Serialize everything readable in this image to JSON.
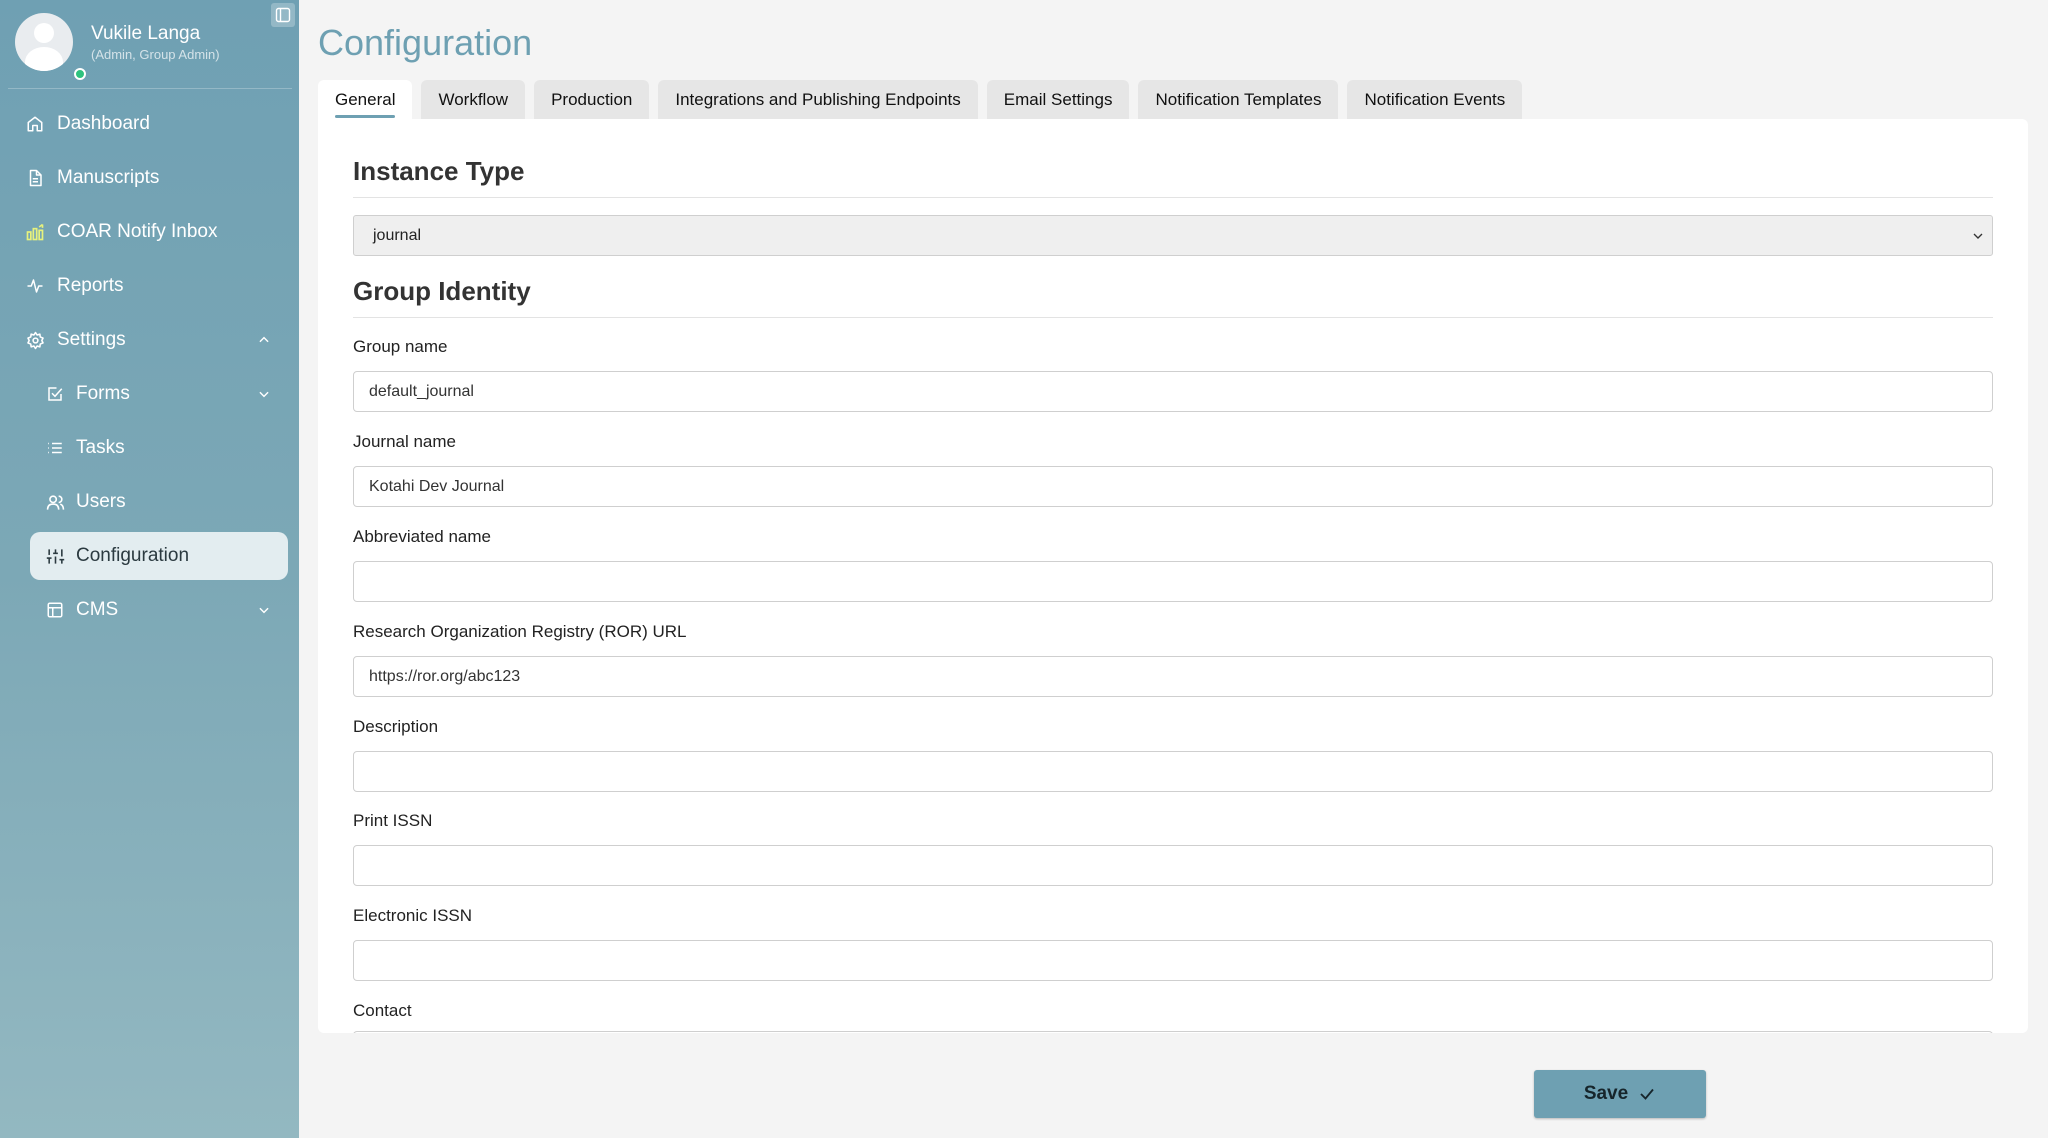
{
  "user": {
    "name": "Vukile Langa",
    "role": "(Admin, Group Admin)",
    "status_color": "#2ec27e"
  },
  "sidebar": {
    "items": [
      {
        "label": "Dashboard",
        "icon": "home-icon"
      },
      {
        "label": "Manuscripts",
        "icon": "document-icon"
      },
      {
        "label": "COAR Notify Inbox",
        "icon": "inbox-chart-icon"
      },
      {
        "label": "Reports",
        "icon": "activity-icon"
      },
      {
        "label": "Settings",
        "icon": "gear-icon",
        "expanded": true
      },
      {
        "label": "Forms",
        "icon": "check-square-icon"
      },
      {
        "label": "Tasks",
        "icon": "list-icon"
      },
      {
        "label": "Users",
        "icon": "users-icon"
      },
      {
        "label": "Configuration",
        "icon": "sliders-icon",
        "active": true
      },
      {
        "label": "CMS",
        "icon": "layout-icon"
      }
    ]
  },
  "page": {
    "title": "Configuration"
  },
  "tabs": [
    {
      "label": "General",
      "active": true
    },
    {
      "label": "Workflow"
    },
    {
      "label": "Production"
    },
    {
      "label": "Integrations and Publishing Endpoints"
    },
    {
      "label": "Email Settings"
    },
    {
      "label": "Notification Templates"
    },
    {
      "label": "Notification Events"
    }
  ],
  "sections": {
    "instance_type": "Instance Type",
    "group_identity": "Group Identity"
  },
  "instance_type": {
    "selected": "journal"
  },
  "fields": {
    "group_name": {
      "label": "Group name",
      "value": "default_journal"
    },
    "journal_name": {
      "label": "Journal name",
      "value": "Kotahi Dev Journal"
    },
    "abbreviated_name": {
      "label": "Abbreviated name",
      "value": ""
    },
    "ror_url": {
      "label": "Research Organization Registry (ROR) URL",
      "value": "https://ror.org/abc123"
    },
    "description": {
      "label": "Description",
      "value": ""
    },
    "print_issn": {
      "label": "Print ISSN",
      "value": ""
    },
    "electronic_issn": {
      "label": "Electronic ISSN",
      "value": ""
    },
    "contact": {
      "label": "Contact",
      "value": ""
    }
  },
  "actions": {
    "save_label": "Save"
  },
  "colors": {
    "accent": "#6ea0b2",
    "sidebar_top": "#6fa0b3",
    "sidebar_bottom": "#93b8c1"
  }
}
